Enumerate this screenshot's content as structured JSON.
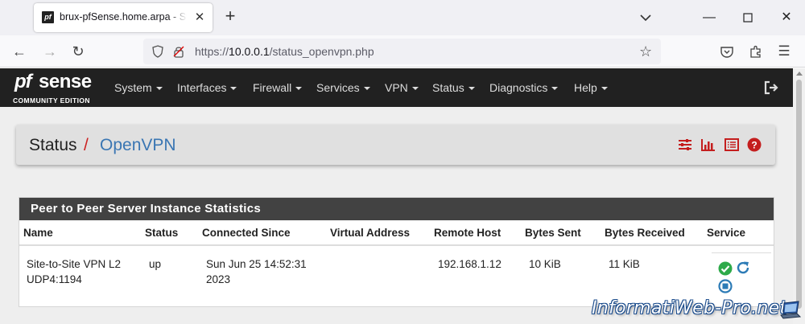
{
  "browser": {
    "tab_title": "brux-pfSense.home.arpa - Status: OpenVPN",
    "favicon_text": "pf",
    "url_prefix": "https://",
    "url_host": "10.0.0.1",
    "url_path": "/status_openvpn.php"
  },
  "pfsense": {
    "logo_pf": "pf",
    "logo_sense": "sense",
    "logo_edition": "COMMUNITY EDITION",
    "menu": [
      "System",
      "Interfaces",
      "Firewall",
      "Services",
      "VPN",
      "Status",
      "Diagnostics",
      "Help"
    ]
  },
  "breadcrumb": {
    "section": "Status",
    "separator": "/",
    "page": "OpenVPN"
  },
  "panel": {
    "title": "Peer to Peer Server Instance Statistics",
    "columns": [
      "Name",
      "Status",
      "Connected Since",
      "Virtual Address",
      "Remote Host",
      "Bytes Sent",
      "Bytes Received",
      "Service"
    ],
    "rows": [
      {
        "name_line1": "Site-to-Site VPN L2",
        "name_line2": "UDP4:1194",
        "status": "up",
        "connected_line1": "Sun Jun 25 14:52:31",
        "connected_line2": "2023",
        "virtual_address": "",
        "remote_host": "192.168.1.12",
        "bytes_sent": "10 KiB",
        "bytes_received": "11 KiB"
      }
    ]
  },
  "watermark": "InformatiWeb-Pro.net",
  "colors": {
    "pfsense_bar": "#212121",
    "breadcrumb_slash": "#cc2222",
    "breadcrumb_link": "#3a76b3",
    "action_icons": "#c41e1e",
    "panel_header": "#424242",
    "service_ok": "#2eaa4a",
    "service_action": "#2c7bb6"
  }
}
